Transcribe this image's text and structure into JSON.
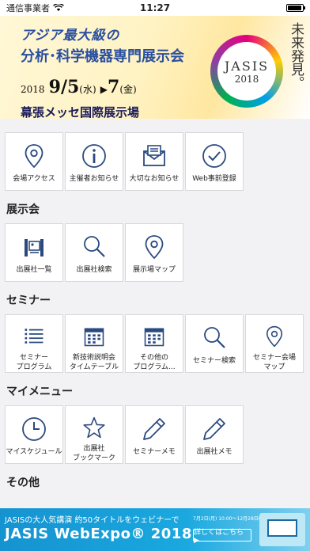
{
  "status_bar": {
    "carrier": "通信事業者",
    "time": "11:27",
    "battery_level": 0.95
  },
  "banner": {
    "line1": "アジア最大級の",
    "line2": "分析･科学機器専門展示会",
    "date_year": "2018",
    "date_main": "9/5",
    "date_end": "7",
    "venue": "幕張メッセ国際展示場",
    "logo_name": "JASIS",
    "logo_year": "2018",
    "catchphrase": "未来発見。"
  },
  "top_menu": [
    {
      "label": "会場アクセス",
      "icon": "map-pin-icon"
    },
    {
      "label": "主催者お知らせ",
      "icon": "info-icon"
    },
    {
      "label": "大切なお知らせ",
      "icon": "mail-icon"
    },
    {
      "label": "Web事前登録",
      "icon": "check-circle-icon"
    }
  ],
  "sections": {
    "exhibition": {
      "title": "展示会",
      "items": [
        {
          "label": "出展社一覧",
          "icon": "booth-icon"
        },
        {
          "label": "出展社検索",
          "icon": "search-icon"
        },
        {
          "label": "展示場マップ",
          "icon": "map-pin-icon"
        }
      ]
    },
    "seminar": {
      "title": "セミナー",
      "items": [
        {
          "label1": "セミナー",
          "label2": "プログラム",
          "icon": "list-icon"
        },
        {
          "label1": "新技術説明会",
          "label2": "タイムテーブル",
          "icon": "calendar-icon"
        },
        {
          "label1": "その他の",
          "label2": "プログラム...",
          "icon": "calendar-icon"
        },
        {
          "label1": "セミナー検索",
          "label2": "",
          "icon": "search-icon"
        },
        {
          "label1": "セミナー会場",
          "label2": "マップ",
          "icon": "map-pin-icon"
        }
      ]
    },
    "mymenu": {
      "title": "マイメニュー",
      "items": [
        {
          "label1": "マイスケジュール",
          "label2": "",
          "icon": "clock-icon"
        },
        {
          "label1": "出展社",
          "label2": "ブックマーク",
          "icon": "star-icon"
        },
        {
          "label1": "セミナーメモ",
          "label2": "",
          "icon": "pencil-icon"
        },
        {
          "label1": "出展社メモ",
          "label2": "",
          "icon": "pencil-icon"
        }
      ]
    },
    "other": {
      "title": "その他"
    }
  },
  "ad": {
    "line1": "JASISの大人気講演 約50タイトルをウェビナーで",
    "title": "JASIS WebExpo® 2018",
    "dates": "7月2日(月) 10:00～12月28日(木) 17:00",
    "button": "詳しくはこちら ▶"
  },
  "colors": {
    "icon": "#2a4a7f",
    "accent_blue": "#1593d1"
  }
}
